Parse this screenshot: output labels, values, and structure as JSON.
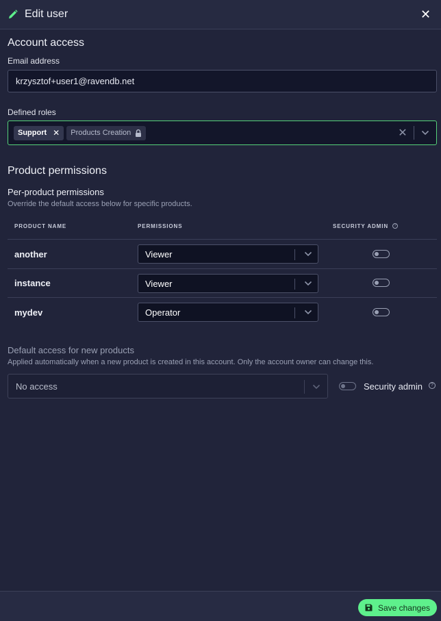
{
  "header": {
    "title": "Edit user",
    "pencil_icon": "pencil-icon",
    "close_icon": "close-icon",
    "close_glyph": "✕"
  },
  "account_access": {
    "heading": "Account access",
    "email_label": "Email address",
    "email_value": "krzysztof+user1@ravendb.net",
    "roles_label": "Defined roles",
    "roles": [
      {
        "label": "Support",
        "removable": true,
        "remove_glyph": "✕"
      },
      {
        "label": "Products Creation",
        "locked": true
      }
    ],
    "clear_glyph": "✕"
  },
  "product_permissions": {
    "heading": "Product permissions",
    "per_product_title": "Per-product permissions",
    "per_product_desc": "Override the default access below for specific products.",
    "columns": {
      "product": "PRODUCT NAME",
      "permissions": "PERMISSIONS",
      "security": "SECURITY ADMIN"
    },
    "help_glyph": "?",
    "rows": [
      {
        "name": "another",
        "permission": "Viewer",
        "security_admin": false
      },
      {
        "name": "instance",
        "permission": "Viewer",
        "security_admin": false
      },
      {
        "name": "mydev",
        "permission": "Operator",
        "security_admin": false
      }
    ]
  },
  "default_access": {
    "title": "Default access for new products",
    "desc": "Applied automatically when a new product is created in this account. Only the account owner can change this.",
    "value": "No access",
    "security_label": "Security admin",
    "security_admin": false,
    "help_glyph": "?"
  },
  "footer": {
    "save_label": "Save changes"
  },
  "colors": {
    "accent": "#5ef08c",
    "background": "#21243a",
    "input": "#13162a",
    "focus_border": "#56d37a"
  }
}
